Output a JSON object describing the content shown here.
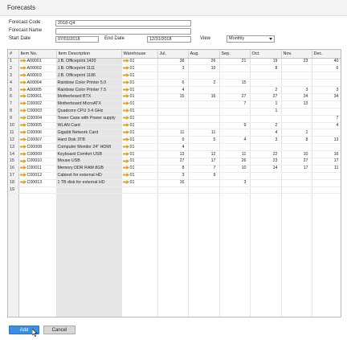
{
  "window": {
    "title": "Forecasts"
  },
  "header": {
    "forecast_code_label": "Forecast Code",
    "forecast_code_value": "2018-Q4",
    "forecast_name_label": "Forecast Name",
    "forecast_name_value": "",
    "start_date_label": "Start Date",
    "start_date_value": "07/01/2018",
    "end_date_label": "End Date",
    "end_date_value": "12/31/2018",
    "view_label": "View",
    "view_value": "Monthly"
  },
  "table": {
    "columns": [
      "#",
      "Item No.",
      "Item Description",
      "Warehouse",
      "Jul.",
      "Aug.",
      "Sep.",
      "Oct.",
      "Nov.",
      "Dec."
    ],
    "rows": [
      {
        "n": "1",
        "item": "A00001",
        "desc": "J.B. Officeprint 1420",
        "wh": "01",
        "m": [
          "38",
          "26",
          "21",
          "19",
          "23",
          "40"
        ]
      },
      {
        "n": "2",
        "item": "A00002",
        "desc": "J.B. Officeprint 1111",
        "wh": "01",
        "m": [
          "3",
          "10",
          "",
          "8",
          "",
          "6"
        ]
      },
      {
        "n": "3",
        "item": "A00003",
        "desc": "J.B. Officeprint 1186",
        "wh": "01",
        "m": [
          "",
          "",
          "",
          "",
          "",
          ""
        ]
      },
      {
        "n": "4",
        "item": "A00004",
        "desc": "Rainbow Color Printer 5.0",
        "wh": "01",
        "m": [
          "6",
          "2",
          "15",
          "",
          "",
          ""
        ]
      },
      {
        "n": "5",
        "item": "A00005",
        "desc": "Rainbow Color Printer 7.5",
        "wh": "01",
        "m": [
          "4",
          "",
          "",
          "2",
          "3",
          "3"
        ]
      },
      {
        "n": "6",
        "item": "C00001",
        "desc": "Motherboard BTX",
        "wh": "01",
        "m": [
          "15",
          "16",
          "27",
          "27",
          "24",
          "34"
        ]
      },
      {
        "n": "7",
        "item": "C00002",
        "desc": "Motherboard MicroATX",
        "wh": "01",
        "m": [
          "",
          "",
          "7",
          "1",
          "13",
          ""
        ]
      },
      {
        "n": "8",
        "item": "C00003",
        "desc": "Quadcore CPU 3.4 GHz",
        "wh": "01",
        "m": [
          "",
          "",
          "",
          "1",
          "",
          ""
        ]
      },
      {
        "n": "9",
        "item": "C00004",
        "desc": "Tower Case with Power supply",
        "wh": "01",
        "m": [
          "",
          "",
          "",
          "",
          "",
          "7"
        ]
      },
      {
        "n": "10",
        "item": "C00005",
        "desc": "WLAN Card",
        "wh": "01",
        "m": [
          "",
          "",
          "9",
          "2",
          "",
          "4"
        ]
      },
      {
        "n": "11",
        "item": "C00006",
        "desc": "Gigabit Network Card",
        "wh": "01",
        "m": [
          "11",
          "11",
          "",
          "4",
          "1",
          ""
        ]
      },
      {
        "n": "12",
        "item": "C00007",
        "desc": "Hard Disk 3TB",
        "wh": "01",
        "m": [
          "9",
          "5",
          "4",
          "3",
          "8",
          "13"
        ]
      },
      {
        "n": "13",
        "item": "C00008",
        "desc": "Computer Monitor 24\" HDMI",
        "wh": "01",
        "m": [
          "4",
          "",
          "",
          "",
          "",
          ""
        ]
      },
      {
        "n": "14",
        "item": "C00009",
        "desc": "Keyboard Comfort USB",
        "wh": "01",
        "m": [
          "13",
          "12",
          "11",
          "22",
          "10",
          "16"
        ]
      },
      {
        "n": "15",
        "item": "C00010",
        "desc": "Mouse USB",
        "wh": "01",
        "m": [
          "27",
          "17",
          "26",
          "23",
          "27",
          "17"
        ]
      },
      {
        "n": "16",
        "item": "C00011",
        "desc": "Memory DDR RAM 8GB",
        "wh": "01",
        "m": [
          "8",
          "7",
          "10",
          "14",
          "17",
          "11"
        ]
      },
      {
        "n": "17",
        "item": "C00012",
        "desc": "Cabinet for external HD",
        "wh": "01",
        "m": [
          "3",
          "9",
          "",
          "",
          "",
          ""
        ]
      },
      {
        "n": "18",
        "item": "C00013",
        "desc": "1 TB disk for external HD",
        "wh": "01",
        "m": [
          "16",
          "",
          "3",
          "",
          "",
          ""
        ]
      },
      {
        "n": "19",
        "item": "",
        "desc": "",
        "wh": "",
        "m": [
          "",
          "",
          "",
          "",
          "",
          ""
        ]
      }
    ]
  },
  "buttons": {
    "add_label": "Add",
    "cancel_label": "Cancel"
  },
  "colors": {
    "link_arrow": "#e0a21a",
    "add_button": "#3a8ee6",
    "description_column": "#e6e6e6"
  },
  "icons": {
    "row_link": "link-arrow-icon",
    "select": "chevron-down-icon",
    "pointer": "mouse-pointer-icon"
  }
}
